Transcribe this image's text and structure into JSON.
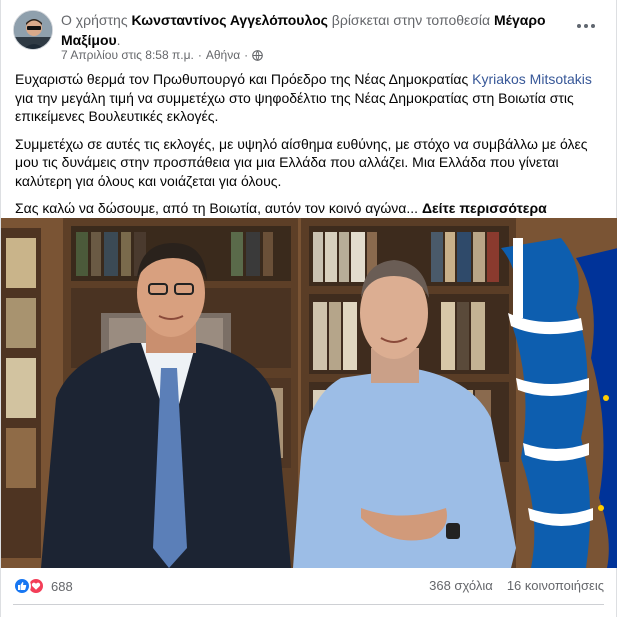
{
  "post": {
    "prefix": "Ο χρήστης ",
    "author": "Κωνσταντίνος Αγγελόπουλος",
    "location_text": " βρίσκεται στην τοποθεσία ",
    "location": "Μέγαρο Μαξίμου",
    "location_suffix": ".",
    "timestamp": "7 Απριλίου στις 8:58 π.μ.",
    "separator": " · ",
    "place": "Αθήνα",
    "paragraph1_a": "Ευχαριστώ θερμά τον Πρωθυπουργό και Πρόεδρο της Νέας Δημοκρατίας ",
    "paragraph1_link": "Kyriakos Mitsotakis",
    "paragraph1_b": " για την μεγάλη τιμή να συμμετέχω στο ψηφοδέλτιο της Νέας Δημοκρατίας στη Βοιωτία στις επικείμενες Βουλευτικές εκλογές.",
    "paragraph2": "Συμμετέχω σε αυτές τις εκλογές, με υψηλό αίσθημα ευθύνης, με στόχο να συμβάλλω με όλες μου τις δυνάμεις στην προσπάθεια για μια Ελλάδα που αλλάζει. Μια Ελλάδα που γίνεται καλύτερη για όλους και νοιάζεται για όλους.",
    "paragraph3": "Σας καλώ να δώσουμε, από τη Βοιωτία, αυτόν τον κοινό αγώνα... ",
    "see_more": "Δείτε περισσότερα"
  },
  "footer": {
    "reaction_count": "688",
    "comments": "368 σχόλια",
    "shares": "16 κοινοποιήσεις"
  },
  "colors": {
    "link": "#385898",
    "like": "#1877f2",
    "love": "#f33e58",
    "flag_blue": "#0d5eaf",
    "eu_blue": "#003399"
  },
  "icons": [
    "globe-icon",
    "more-options-icon",
    "like-reaction-icon",
    "love-reaction-icon"
  ]
}
